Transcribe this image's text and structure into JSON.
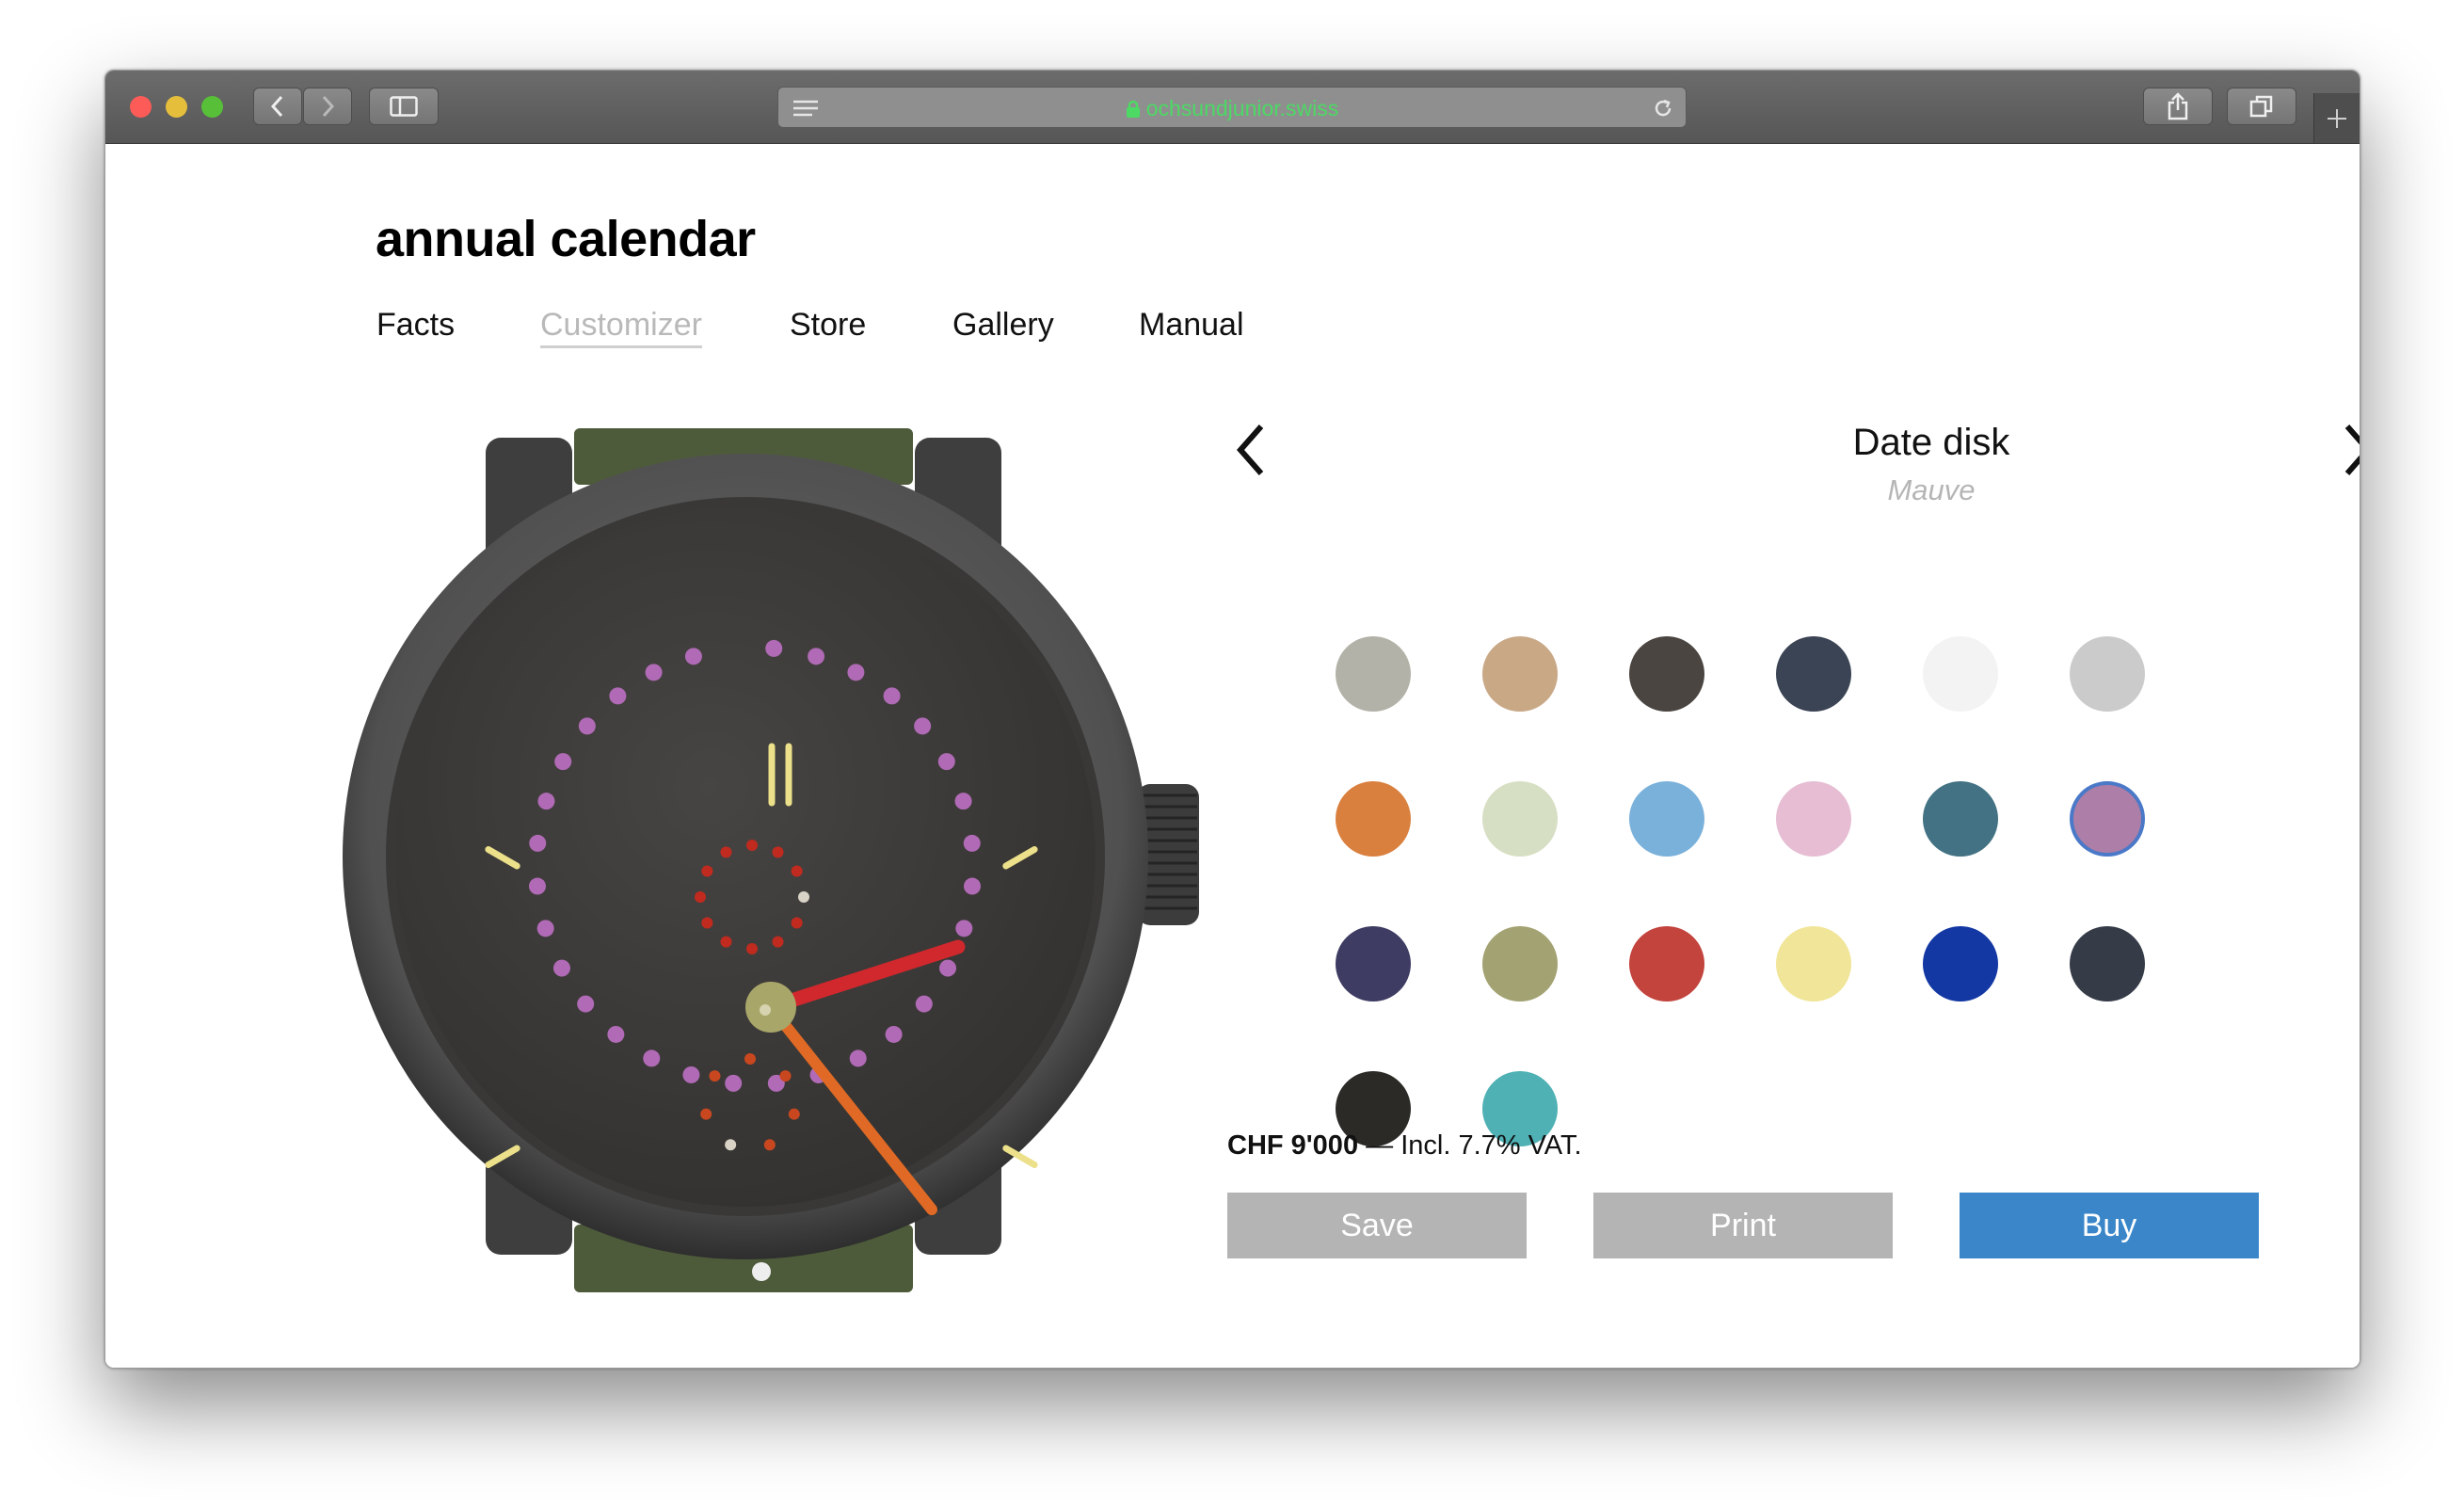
{
  "browser": {
    "url": "ochsundjunior.swiss",
    "traffic_lights": [
      "#fc5b57",
      "#e5bf3c",
      "#57c038"
    ]
  },
  "page": {
    "title": "annual calendar",
    "nav": [
      {
        "label": "Facts",
        "active": false
      },
      {
        "label": "Customizer",
        "active": true
      },
      {
        "label": "Store",
        "active": false
      },
      {
        "label": "Gallery",
        "active": false
      },
      {
        "label": "Manual",
        "active": false
      }
    ]
  },
  "customizer": {
    "section_title": "Date disk",
    "selected_color_name": "Mauve",
    "swatches": [
      {
        "color": "#b3b2a8",
        "selected": false
      },
      {
        "color": "#c9a886",
        "selected": false
      },
      {
        "color": "#4a4541",
        "selected": false
      },
      {
        "color": "#3b4454",
        "selected": false
      },
      {
        "color": "#f3f3f3",
        "selected": false
      },
      {
        "color": "#cbcbcb",
        "selected": false
      },
      {
        "color": "#d9803f",
        "selected": false
      },
      {
        "color": "#d6dfc4",
        "selected": false
      },
      {
        "color": "#7ab1db",
        "selected": false
      },
      {
        "color": "#e6bdd3",
        "selected": false
      },
      {
        "color": "#427283",
        "selected": false
      },
      {
        "color": "#ad7ea8",
        "selected": true
      },
      {
        "color": "#3e3c62",
        "selected": false
      },
      {
        "color": "#a3a272",
        "selected": false
      },
      {
        "color": "#c3433d",
        "selected": false
      },
      {
        "color": "#f0e598",
        "selected": false
      },
      {
        "color": "#1338a3",
        "selected": false
      },
      {
        "color": "#353b47",
        "selected": false
      },
      {
        "color": "#2b2a27",
        "selected": false
      },
      {
        "color": "#4fb1b4",
        "selected": false
      }
    ],
    "price_amount": "CHF 9'000",
    "price_note": "— Incl. 7.7% VAT.",
    "buttons": {
      "save": "Save",
      "print": "Print",
      "buy": "Buy"
    },
    "colors": {
      "button_gray": "#b4b4b4",
      "button_buy": "#3a86c8"
    }
  },
  "watch": {
    "strap_color": "#4d5b3a",
    "case_color": "#4b4b4b",
    "dial_color": "#3f3d3b",
    "index_color": "#ece08a",
    "date_dot_color": "#b06ab6",
    "month_dot_color": "#c12a1f",
    "day_dot_color": "#c9471f",
    "hour_hand_color": "#d0282d",
    "minute_hand_color": "#e06a25",
    "center_color": "#a9a66a"
  }
}
